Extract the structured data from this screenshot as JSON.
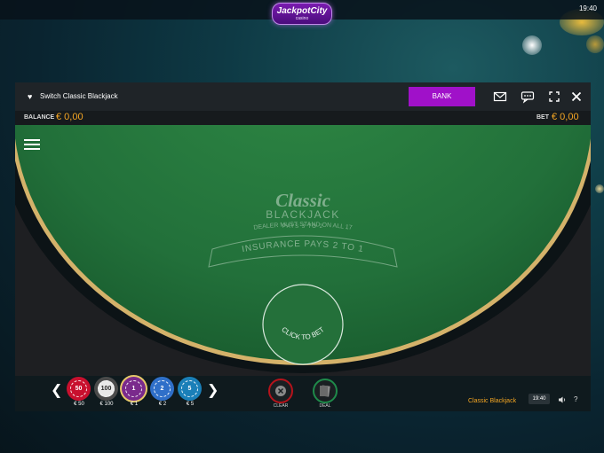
{
  "topbar": {
    "logo_name": "JackpotCity",
    "logo_sub": "casino",
    "clock": "19:40"
  },
  "window": {
    "title": "Switch Classic Blackjack",
    "bank_label": "BANK",
    "icons": [
      "heart-icon",
      "mail-icon",
      "chat-icon",
      "fullscreen-icon",
      "close-icon"
    ]
  },
  "infobar": {
    "balance_label": "BALANCE",
    "balance_value": "€ 0,00",
    "bet_label": "BET",
    "bet_value": "€ 0,00"
  },
  "table": {
    "logo_script": "Classic",
    "logo_main": "BLACKJACK",
    "pays": "PAYS 3 TO 2",
    "dealer_rule": "DEALER MUST STAND ON ALL 17",
    "insurance": "INSURANCE PAYS 2 TO 1",
    "bet_spot": "CLICK TO BET"
  },
  "chips": [
    {
      "face": "50",
      "label": "€ 50",
      "color": "#c8102e"
    },
    {
      "face": "100",
      "label": "€ 100",
      "color": "#4a4a4a"
    },
    {
      "face": "1",
      "label": "€ 1",
      "color": "#7a2a8c",
      "selected": true
    },
    {
      "face": "2",
      "label": "€ 2",
      "color": "#2f6fc9"
    },
    {
      "face": "5",
      "label": "€ 5",
      "color": "#1a7fb8"
    }
  ],
  "controls": {
    "clear_label": "CLEAR",
    "deal_label": "DEAL",
    "prev_arrow": "❮",
    "next_arrow": "❯"
  },
  "footer": {
    "game_name": "Classic Blackjack",
    "clock": "19:40",
    "help": "?"
  },
  "colors": {
    "accent": "#a011c9",
    "money": "#f5a623",
    "felt": "#2a7a3c"
  }
}
